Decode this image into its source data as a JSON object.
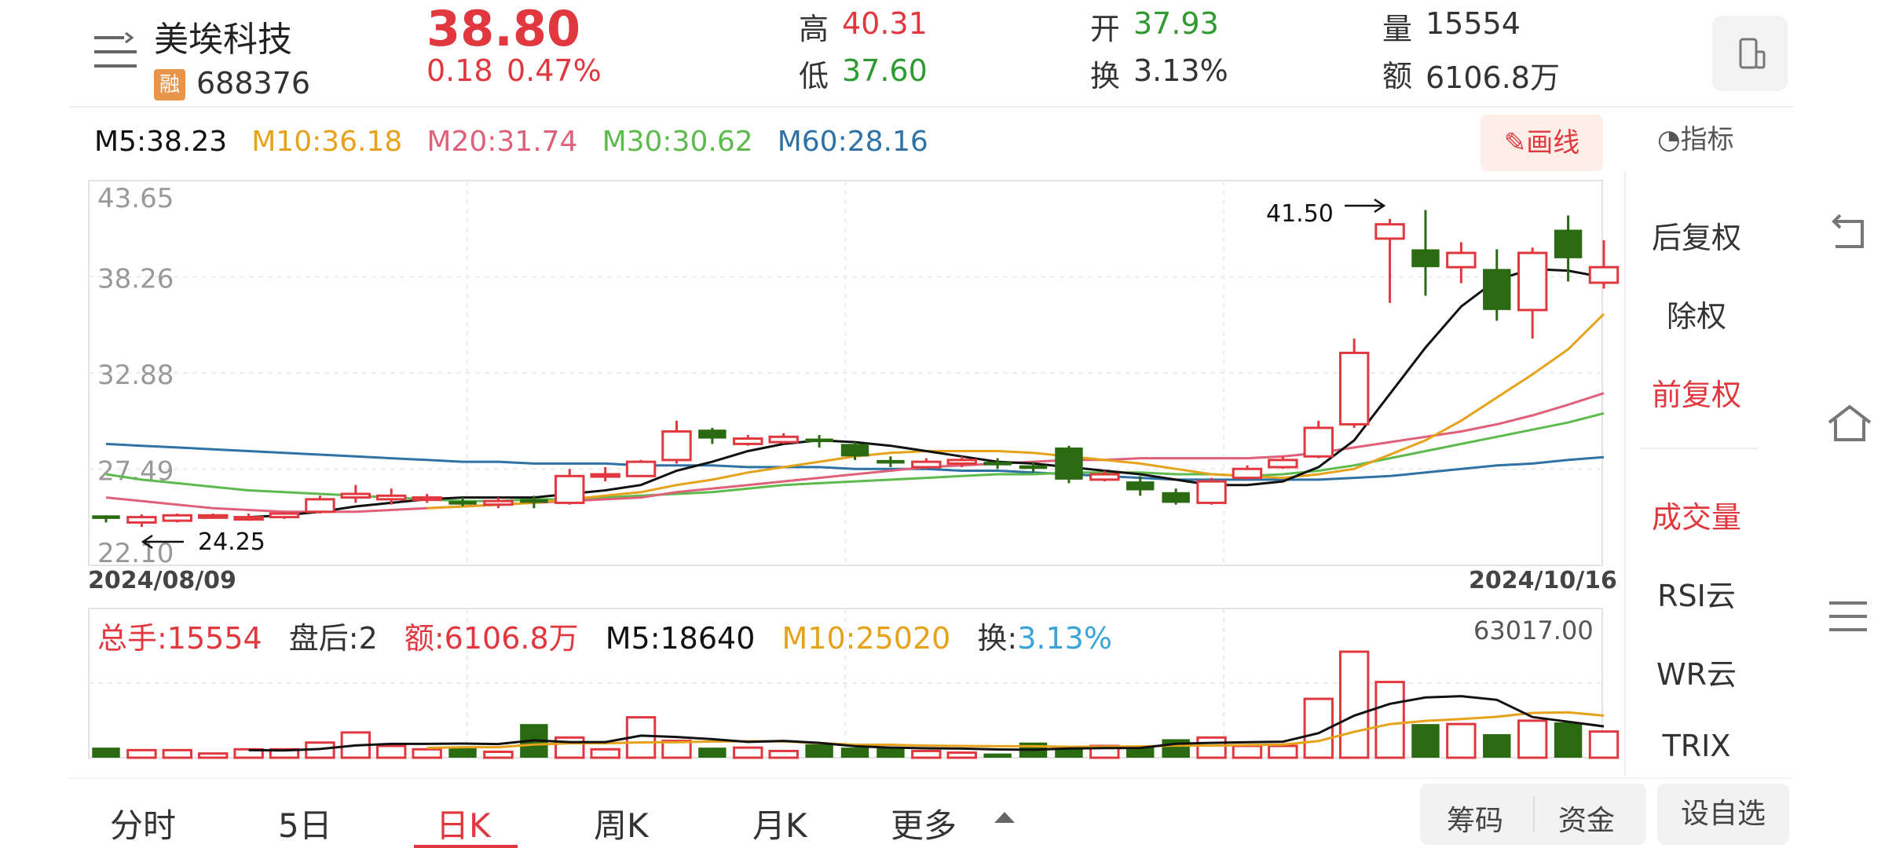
{
  "stock": {
    "name": "美埃科技",
    "margin_badge": "融",
    "code": "688376",
    "price": "38.80",
    "change": "0.18",
    "change_pct": "0.47%"
  },
  "quote": {
    "high_label": "高",
    "high": "40.31",
    "low_label": "低",
    "low": "37.60",
    "open_label": "开",
    "open": "37.93",
    "turnover_label": "换",
    "turnover": "3.13%",
    "volume_label": "量",
    "volume": "15554",
    "amount_label": "额",
    "amount": "6106.8万"
  },
  "ma_legend": [
    {
      "label": "M5:38.23",
      "color": "#111111"
    },
    {
      "label": "M10:36.18",
      "color": "#e5a21a"
    },
    {
      "label": "M20:31.74",
      "color": "#e0607a"
    },
    {
      "label": "M30:30.62",
      "color": "#5dbb4d"
    },
    {
      "label": "M60:28.16",
      "color": "#2e72a6"
    }
  ],
  "draw_button": "画线",
  "indicator_button": "指标",
  "right_panel": {
    "items": [
      "后复权",
      "除权",
      "前复权",
      "成交量",
      "RSI云",
      "WR云",
      "TRIX"
    ],
    "active": [
      "前复权",
      "成交量"
    ]
  },
  "volume_legend": {
    "total": "总手:15554",
    "after_hours": "盘后:2",
    "amount": "额:6106.8万",
    "m5": "M5:18640",
    "m10": "M10:25020",
    "turnover_label": "换:",
    "turnover_value": "3.13%",
    "max": "63017.00"
  },
  "tabs": [
    "分时",
    "5日",
    "日K",
    "周K",
    "月K",
    "更多"
  ],
  "active_tab": "日K",
  "bottom_buttons": {
    "chips": "筹码",
    "funds": "资金",
    "add_watch": "设自选"
  },
  "chart_data": {
    "type": "candlestick",
    "x_start": "2024/08/09",
    "x_end": "2024/10/16",
    "y_ticks": [
      43.65,
      38.26,
      32.88,
      27.49,
      22.1
    ],
    "ylim": [
      22.1,
      43.65
    ],
    "annotations": [
      {
        "label": "41.50",
        "value": 41.5,
        "kind": "high"
      },
      {
        "label": "24.25",
        "value": 24.25,
        "kind": "low"
      }
    ],
    "candles": [
      [
        24.9,
        24.7,
        24.9,
        24.5,
        "down"
      ],
      [
        24.5,
        24.8,
        24.95,
        24.25,
        "up"
      ],
      [
        24.6,
        24.9,
        25.0,
        24.5,
        "up"
      ],
      [
        24.8,
        24.9,
        25.0,
        24.7,
        "up"
      ],
      [
        24.7,
        24.8,
        25.0,
        24.6,
        "up"
      ],
      [
        24.8,
        25.0,
        25.1,
        24.7,
        "up"
      ],
      [
        25.1,
        25.8,
        26.0,
        25.0,
        "up"
      ],
      [
        25.9,
        26.1,
        26.6,
        25.6,
        "up"
      ],
      [
        25.8,
        26.0,
        26.4,
        25.5,
        "up"
      ],
      [
        25.8,
        25.9,
        26.1,
        25.6,
        "up"
      ],
      [
        25.7,
        25.5,
        25.9,
        25.4,
        "down"
      ],
      [
        25.5,
        25.7,
        25.9,
        25.3,
        "up"
      ],
      [
        25.8,
        25.6,
        26.0,
        25.3,
        "down"
      ],
      [
        25.6,
        27.1,
        27.5,
        25.5,
        "up"
      ],
      [
        27.2,
        27.2,
        27.6,
        26.8,
        "up"
      ],
      [
        27.1,
        27.9,
        28.0,
        27.1,
        "up"
      ],
      [
        28.0,
        29.6,
        30.2,
        27.8,
        "up"
      ],
      [
        29.7,
        29.2,
        29.8,
        28.9,
        "down"
      ],
      [
        28.9,
        29.2,
        29.4,
        28.8,
        "up"
      ],
      [
        29.0,
        29.3,
        29.5,
        28.9,
        "up"
      ],
      [
        29.2,
        29.0,
        29.4,
        28.7,
        "down"
      ],
      [
        28.9,
        28.2,
        29.0,
        28.0,
        "down"
      ],
      [
        28.0,
        27.8,
        28.2,
        27.6,
        "down"
      ],
      [
        27.6,
        27.9,
        28.1,
        27.5,
        "up"
      ],
      [
        27.8,
        28.0,
        28.2,
        27.6,
        "up"
      ],
      [
        27.9,
        27.7,
        28.1,
        27.5,
        "down"
      ],
      [
        27.7,
        27.5,
        27.9,
        27.3,
        "down"
      ],
      [
        28.7,
        26.9,
        28.8,
        26.7,
        "down"
      ],
      [
        26.9,
        27.2,
        27.4,
        26.8,
        "up"
      ],
      [
        26.8,
        26.3,
        27.1,
        26.0,
        "down"
      ],
      [
        26.2,
        25.6,
        26.4,
        25.5,
        "down"
      ],
      [
        25.6,
        26.8,
        27.0,
        25.5,
        "up"
      ],
      [
        27.0,
        27.5,
        27.7,
        26.9,
        "up"
      ],
      [
        27.6,
        28.0,
        28.2,
        27.5,
        "up"
      ],
      [
        28.2,
        29.8,
        30.2,
        28.1,
        "up"
      ],
      [
        30.0,
        34.0,
        34.8,
        29.8,
        "up"
      ],
      [
        40.4,
        41.2,
        41.5,
        36.8,
        "up"
      ],
      [
        39.8,
        38.8,
        42.0,
        37.2,
        "down"
      ],
      [
        38.8,
        39.6,
        40.2,
        37.9,
        "up"
      ],
      [
        38.7,
        36.4,
        39.8,
        35.8,
        "down"
      ],
      [
        36.4,
        39.6,
        39.9,
        34.8,
        "up"
      ],
      [
        40.9,
        39.3,
        41.7,
        38.0,
        "down"
      ],
      [
        37.93,
        38.8,
        40.31,
        37.6,
        "up"
      ]
    ],
    "ma": {
      "M5": [
        null,
        null,
        null,
        null,
        24.8,
        24.9,
        25.1,
        25.4,
        25.6,
        25.8,
        25.9,
        25.9,
        25.9,
        26.1,
        26.3,
        26.6,
        27.4,
        27.9,
        28.5,
        28.9,
        29.1,
        29.0,
        28.8,
        28.5,
        28.2,
        27.9,
        27.8,
        27.6,
        27.4,
        27.2,
        26.9,
        26.6,
        26.6,
        26.8,
        27.6,
        29.1,
        31.7,
        34.3,
        36.6,
        38.1,
        38.7,
        38.6,
        38.23
      ],
      "M10": [
        null,
        null,
        null,
        null,
        null,
        null,
        null,
        null,
        null,
        25.3,
        25.4,
        25.5,
        25.6,
        25.8,
        26.0,
        26.2,
        26.6,
        26.9,
        27.3,
        27.6,
        27.9,
        28.2,
        28.4,
        28.5,
        28.5,
        28.5,
        28.4,
        28.2,
        28.0,
        27.8,
        27.5,
        27.2,
        27.1,
        27.0,
        27.2,
        27.5,
        28.3,
        29.1,
        30.2,
        31.5,
        32.8,
        34.2,
        36.18
      ],
      "M20": [
        25.9,
        25.7,
        25.5,
        25.3,
        25.2,
        25.1,
        25.1,
        25.1,
        25.2,
        25.3,
        25.4,
        25.5,
        25.6,
        25.7,
        25.8,
        25.9,
        26.2,
        26.4,
        26.6,
        26.8,
        27.0,
        27.2,
        27.4,
        27.6,
        27.7,
        27.8,
        27.9,
        28.0,
        28.0,
        28.1,
        28.1,
        28.1,
        28.1,
        28.2,
        28.4,
        28.7,
        29.0,
        29.3,
        29.6,
        30.0,
        30.5,
        31.1,
        31.74
      ],
      "M30": [
        27.2,
        26.9,
        26.7,
        26.5,
        26.3,
        26.2,
        26.1,
        26.0,
        25.9,
        25.8,
        25.7,
        25.7,
        25.8,
        25.8,
        25.9,
        26.0,
        26.1,
        26.2,
        26.4,
        26.6,
        26.7,
        26.8,
        26.9,
        27.0,
        27.1,
        27.2,
        27.2,
        27.3,
        27.3,
        27.3,
        27.2,
        27.2,
        27.1,
        27.2,
        27.4,
        27.7,
        28.1,
        28.5,
        28.9,
        29.3,
        29.7,
        30.1,
        30.62
      ],
      "M60": [
        28.9,
        28.8,
        28.7,
        28.6,
        28.5,
        28.4,
        28.3,
        28.2,
        28.1,
        28.0,
        27.9,
        27.9,
        27.8,
        27.8,
        27.8,
        27.7,
        27.7,
        27.7,
        27.6,
        27.6,
        27.6,
        27.5,
        27.5,
        27.5,
        27.4,
        27.4,
        27.3,
        27.2,
        27.1,
        27.0,
        26.9,
        26.9,
        26.9,
        26.9,
        26.9,
        27.0,
        27.1,
        27.3,
        27.5,
        27.7,
        27.8,
        28.0,
        28.16
      ]
    },
    "volume": {
      "max": 63017.0,
      "values": [
        6000,
        4500,
        4500,
        2500,
        5000,
        5000,
        9000,
        15000,
        7000,
        5000,
        6000,
        3500,
        20000,
        12000,
        5000,
        24000,
        10000,
        6000,
        6000,
        4000,
        8000,
        6000,
        6000,
        4000,
        3000,
        2500,
        9000,
        7000,
        7000,
        7000,
        11000,
        12000,
        7000,
        7000,
        35000,
        63017,
        45000,
        20000,
        20000,
        14000,
        22000,
        21000,
        15554
      ],
      "m5": [
        null,
        null,
        null,
        null,
        4500,
        4300,
        5200,
        7300,
        8200,
        8200,
        8400,
        8100,
        10300,
        9300,
        9300,
        13100,
        12300,
        11000,
        9400,
        10000,
        8800,
        6800,
        6000,
        5600,
        5400,
        4900,
        4700,
        5500,
        5700,
        5800,
        8300,
        8800,
        9200,
        9500,
        14600,
        25000,
        32000,
        35800,
        36600,
        34400,
        24200,
        21400,
        18640
      ],
      "m10": [
        null,
        null,
        null,
        null,
        null,
        null,
        null,
        null,
        null,
        5850,
        6250,
        6250,
        7800,
        8600,
        8600,
        9100,
        9200,
        9600,
        9800,
        9700,
        8700,
        7700,
        7700,
        7200,
        7000,
        6800,
        6800,
        6500,
        6600,
        6700,
        7200,
        7200,
        7500,
        7800,
        9900,
        15400,
        20000,
        21900,
        23000,
        24300,
        26600,
        27000,
        25020
      ]
    }
  }
}
